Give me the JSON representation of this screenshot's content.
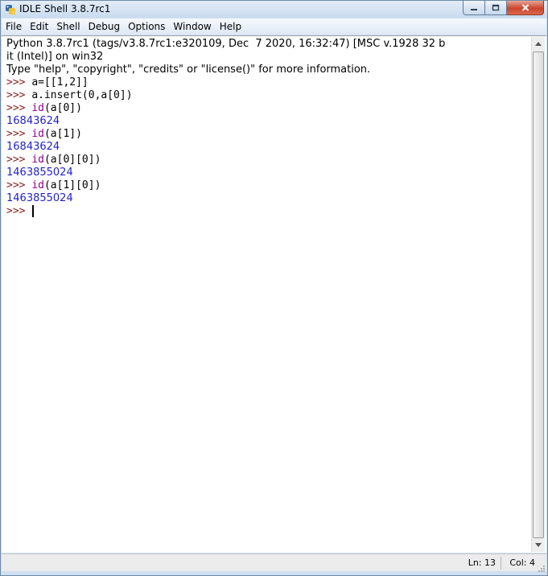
{
  "window": {
    "title": "IDLE Shell 3.8.7rc1"
  },
  "menu": [
    {
      "label": "File",
      "name": "menu-file"
    },
    {
      "label": "Edit",
      "name": "menu-edit"
    },
    {
      "label": "Shell",
      "name": "menu-shell"
    },
    {
      "label": "Debug",
      "name": "menu-debug"
    },
    {
      "label": "Options",
      "name": "menu-options"
    },
    {
      "label": "Window",
      "name": "menu-window"
    },
    {
      "label": "Help",
      "name": "menu-help"
    }
  ],
  "shell": {
    "banner_line1": "Python 3.8.7rc1 (tags/v3.8.7rc1:e320109, Dec  7 2020, 16:32:47) [MSC v.1928 32 b",
    "banner_line2": "it (Intel)] on win32",
    "banner_line3": "Type \"help\", \"copyright\", \"credits\" or \"license()\" for more information.",
    "prompt": ">>> ",
    "entries": [
      {
        "input_builtin": "",
        "input_rest": "a=[[1,2]]",
        "output": ""
      },
      {
        "input_builtin": "",
        "input_rest": "a.insert(0,a[0])",
        "output": ""
      },
      {
        "input_builtin": "id",
        "input_rest": "(a[0])",
        "output": "16843624"
      },
      {
        "input_builtin": "id",
        "input_rest": "(a[1])",
        "output": "16843624"
      },
      {
        "input_builtin": "id",
        "input_rest": "(a[0][0])",
        "output": "1463855024"
      },
      {
        "input_builtin": "id",
        "input_rest": "(a[1][0])",
        "output": "1463855024"
      }
    ]
  },
  "status": {
    "line": "Ln: 13",
    "col": "Col: 4"
  },
  "colors": {
    "prompt": "#8b1c1c",
    "builtin": "#900090",
    "output": "#1f1fcf"
  },
  "icons": {
    "app": "python-idle-icon",
    "minimize": "minimize-icon",
    "maximize": "maximize-icon",
    "close": "close-icon"
  }
}
